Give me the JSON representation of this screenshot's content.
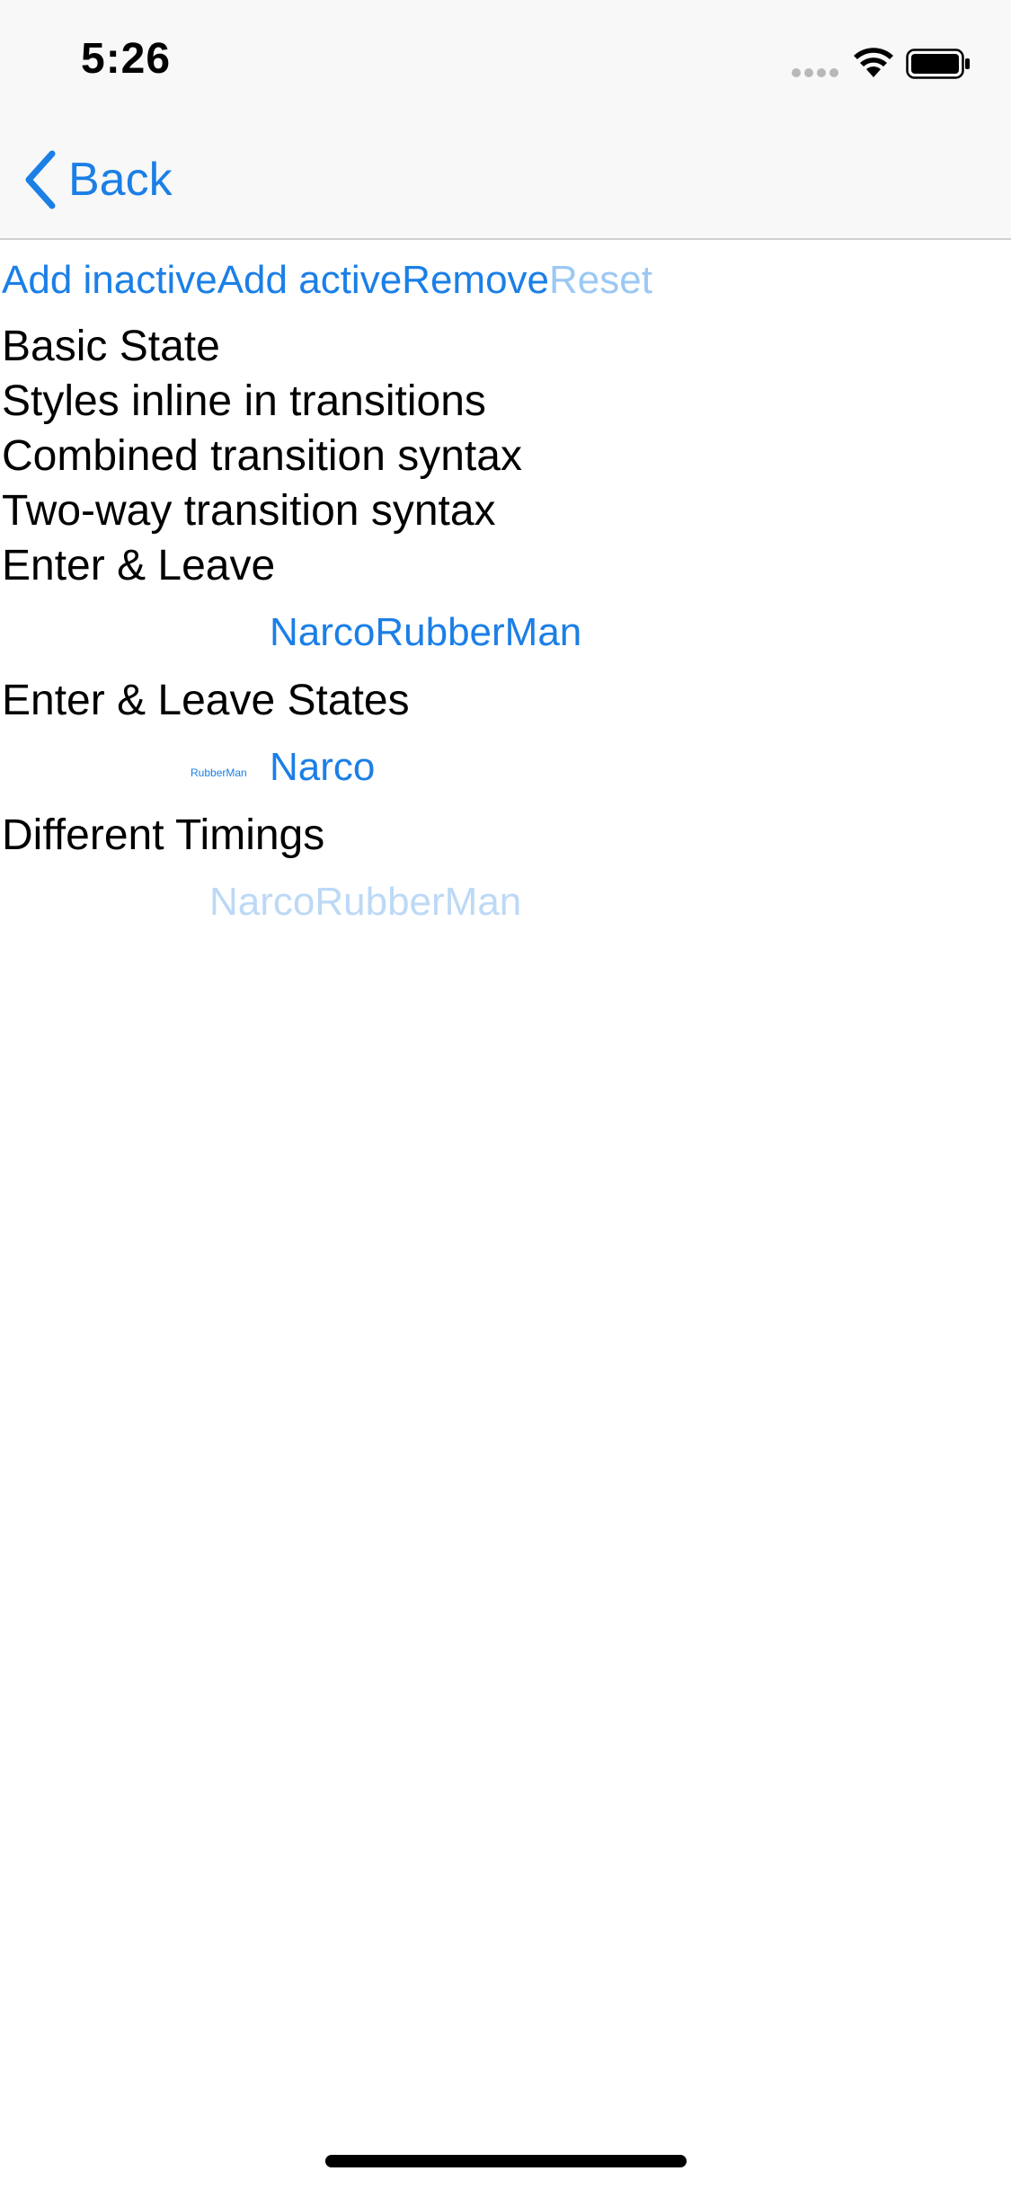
{
  "status_bar": {
    "time": "5:26"
  },
  "nav": {
    "back_label": "Back"
  },
  "actions": {
    "add_inactive": "Add inactive",
    "add_active": "Add active",
    "remove": "Remove",
    "reset": "Reset"
  },
  "sections": {
    "basic_state": "Basic State",
    "styles_inline": "Styles inline in transitions",
    "combined": "Combined transition syntax",
    "two_way": "Two-way transition syntax",
    "enter_leave": "Enter & Leave",
    "enter_leave_item": "NarcoRubberMan",
    "enter_leave_states": "Enter & Leave States",
    "enter_leave_states_small": "RubberMan",
    "enter_leave_states_item": "Narco",
    "different_timings": "Different Timings",
    "different_timings_item": "NarcoRubberMan"
  },
  "colors": {
    "accent": "#1b7fe6",
    "disabled": "#9cc8f3",
    "faded": "#bcd9f6"
  },
  "icons": {
    "back": "chevron-left-icon",
    "signal": "signal-dots-icon",
    "wifi": "wifi-icon",
    "battery": "battery-icon"
  }
}
